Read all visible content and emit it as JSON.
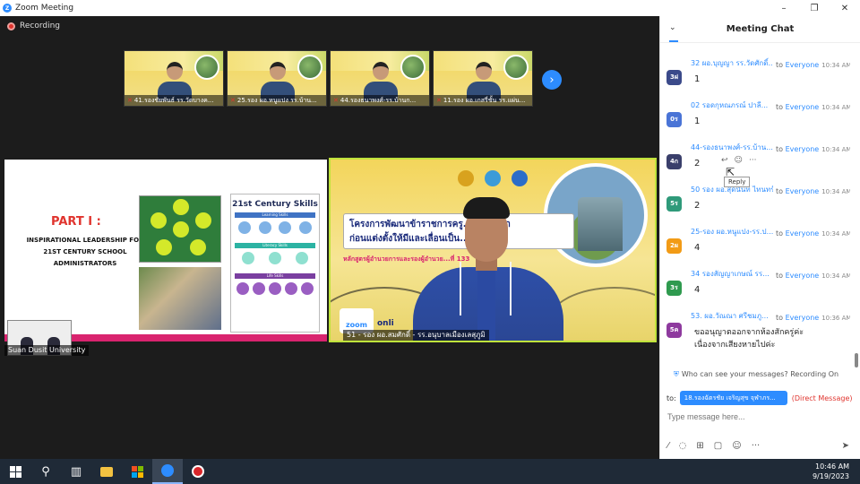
{
  "window": {
    "title": "Zoom Meeting",
    "controls": {
      "minimize": "–",
      "restore": "❐",
      "close": "✕"
    }
  },
  "meeting": {
    "recording_label": "Recording",
    "thumbnails": [
      {
        "name": "41.รองชัยพันธ์ รร.วัดบางค..."
      },
      {
        "name": "25.รอง ผอ.หนูแปง รร.บ้าน..."
      },
      {
        "name": "44.รองธนาพงศ์-รร.บ้านก..."
      },
      {
        "name": "11.รอง ผอ.เกสรี่ชั้น รร.แผ่น..."
      }
    ],
    "next_icon": "›",
    "slide": {
      "part_title": "PART I :",
      "subtitle_1": "INSPIRATIONAL LEADERSHIP FOR",
      "subtitle_2": "21ST CENTURY SCHOOL",
      "subtitle_3": "ADMINISTRATORS",
      "skills_title": "21st Century Skills",
      "learning": "Learning Skills",
      "literacy": "Literacy Skills",
      "life": "Life Skills",
      "participant_label": "Suan Dusit University"
    },
    "speaker": {
      "banner_line1": "โครงการพัฒนาข้าราชการครู...การศึกษา",
      "banner_line2": "ก่อนแต่งตั้งให้มีและเลื่อนเป็น...",
      "course": "หลักสูตรผู้อำนวยการและรองผู้อำนวย...ที่ 133",
      "zoom_label": "zoom",
      "online_label": "onli",
      "name": "51 - รอง ผอ.สมศักดิ์ - รร.อนุบาลเมืองเลสุภูมิ"
    }
  },
  "chat": {
    "title": "Meeting Chat",
    "chevron": "⌄",
    "messages": [
      {
        "avatar": "3ฝ",
        "avatar_color": "#3b4a8a",
        "sender": "32 ผอ.บุญญา รร.วัดศักดิ์...",
        "to_label": "to",
        "recipient": "Everyone",
        "time": "10:34 AM",
        "text": "1"
      },
      {
        "avatar": "0ร",
        "avatar_color": "#4a74d6",
        "sender": "02 รอดกุหณภรณ์ ปาลี...",
        "to_label": "to",
        "recipient": "Everyone",
        "time": "10:34 AM",
        "text": "1"
      },
      {
        "avatar": "4ก",
        "avatar_color": "#3a3f6b",
        "sender": "44-รองธนาพงศ์-รร.บ้าน...",
        "to_label": "to",
        "recipient": "Everyone",
        "time": "10:34 AM",
        "text": "2"
      },
      {
        "avatar": "5ร",
        "avatar_color": "#2f9a7a",
        "sender": "50 รอง ผอ.สุดนันท์ ไทนทร์...",
        "to_label": "to",
        "recipient": "Everyone",
        "time": "10:34 AM",
        "text": "2"
      },
      {
        "avatar": "2ผ",
        "avatar_color": "#f29b16",
        "sender": "25-รอง ผอ.หนูแปง-รร.ป...",
        "to_label": "to",
        "recipient": "Everyone",
        "time": "10:34 AM",
        "text": "4"
      },
      {
        "avatar": "3ร",
        "avatar_color": "#2f9a4f",
        "sender": "34 รองสัญญาเกษณ์ รร...",
        "to_label": "to",
        "recipient": "Everyone",
        "time": "10:34 AM",
        "text": "4"
      },
      {
        "avatar": "5ค",
        "avatar_color": "#8e3a9e",
        "sender": "53. ผอ.วัณณา ศรีชมภู...",
        "to_label": "to",
        "recipient": "Everyone",
        "time": "10:36 AM",
        "text": "ขออนุญาตออกจากห้องสักครู่ค่ะ\nเนื่องจากเสียงหายไปค่ะ"
      }
    ],
    "hover_actions": {
      "react": "☺",
      "reply": "↩",
      "more": "···"
    },
    "reply_tooltip": "Reply",
    "notice": "Who can see your messages? Recording On",
    "to_label": "to:",
    "to_value": "18.รองฉัตรชัย เจริญสุข จุฬาภร...",
    "dm_label": "(Direct Message)",
    "input_placeholder": "Type message here...",
    "tools": [
      "⁄",
      "◌",
      "⊞",
      "▢",
      "☺",
      "···"
    ],
    "send_icon": "➤"
  },
  "taskbar": {
    "time": "10:46 AM",
    "date": "9/19/2023"
  }
}
